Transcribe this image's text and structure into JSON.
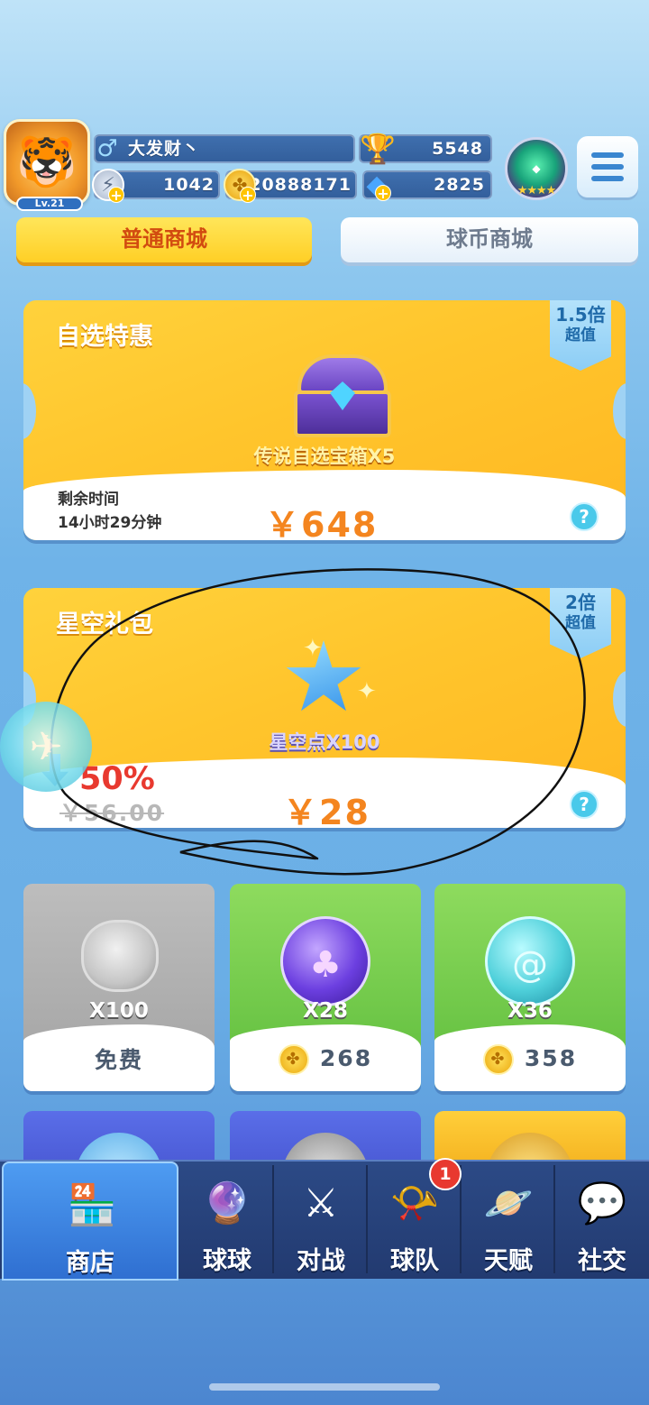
{
  "player": {
    "level": "Lv.21",
    "name": "大发财丶",
    "trophies": "5548",
    "stamina": "1042",
    "coins": "20888171",
    "gems": "2825",
    "rank_stars": "★★★★"
  },
  "tabs": {
    "normal": "普通商城",
    "ballcoin": "球币商城"
  },
  "offer1": {
    "title": "自选特惠",
    "ribbon_line1": "1.5倍",
    "ribbon_line2": "超值",
    "item": "传说自选宝箱X5",
    "time_label": "剩余时间",
    "time_value": "14小时29分钟",
    "price": "￥648",
    "help": "?"
  },
  "offer2": {
    "title": "星空礼包",
    "ribbon_line1": "2倍",
    "ribbon_line2": "超值",
    "item": "星空点X100",
    "discount": "50%",
    "old_price": "￥56.00",
    "price": "￥28",
    "help": "?"
  },
  "grid": [
    {
      "qty": "X100",
      "price": "免费"
    },
    {
      "qty": "X28",
      "price": "268"
    },
    {
      "qty": "X36",
      "price": "358"
    }
  ],
  "nav": [
    {
      "label": "商店",
      "icon": "shop-icon"
    },
    {
      "label": "球球",
      "icon": "ball-icon"
    },
    {
      "label": "对战",
      "icon": "swords-icon"
    },
    {
      "label": "球队",
      "icon": "whistle-icon"
    },
    {
      "label": "天赋",
      "icon": "planet-icon"
    },
    {
      "label": "社交",
      "icon": "chat-icon"
    }
  ],
  "nav_badge": "1",
  "colors": {
    "card_yellow": "#ffc52c",
    "price_orange": "#f4851f",
    "discount_red": "#e8392f",
    "nav_bg": "#2c4a86",
    "tab_active_text": "#d24b10"
  }
}
